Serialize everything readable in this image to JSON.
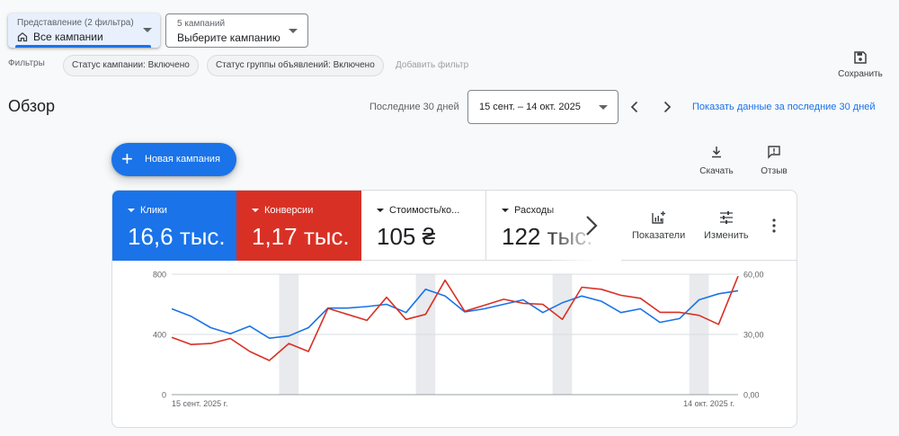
{
  "view_select": {
    "sub": "Представление (2 фильтра)",
    "value": "Все кампании"
  },
  "campaign_select": {
    "sub": "5 кампаний",
    "value": "Выберите кампанию"
  },
  "filters": {
    "label": "Фильтры",
    "chips": [
      "Статус кампании: Включено",
      "Статус группы объявлений: Включено"
    ],
    "add": "Добавить фильтр"
  },
  "save_label": "Сохранить",
  "title": "Обзор",
  "period_label": "Последние 30 дней",
  "date_range": "15 сент. – 14 окт. 2025",
  "show_link": "Показать данные за последние 30 дней",
  "new_campaign": "Новая кампания",
  "download_label": "Скачать",
  "feedback_label": "Отзыв",
  "metrics": [
    {
      "label": "Клики",
      "value": "16,6 тыс.",
      "color": "#1a73e8"
    },
    {
      "label": "Конверсии",
      "value": "1,17 тыс.",
      "color": "#d93025"
    },
    {
      "label": "Стоимость/ко...",
      "value": "105 ₴"
    },
    {
      "label": "Расходы",
      "value": "122 тыс. ₴"
    }
  ],
  "metrics_tools": {
    "indicators": "Показатели",
    "edit": "Изменить"
  },
  "chart_data": {
    "type": "line",
    "x_labels": [
      "15 сент. 2025 г.",
      "14 окт. 2025 г."
    ],
    "y_left": {
      "ticks": [
        "0",
        "400",
        "800"
      ],
      "max": 800
    },
    "y_right": {
      "ticks": [
        "0,00",
        "30,00",
        "60,00"
      ],
      "max": 60
    },
    "weekend_bands": [
      6,
      13,
      20,
      27
    ],
    "series": [
      {
        "name": "Клики",
        "color": "#1a73e8",
        "axis": "left",
        "values": [
          570,
          520,
          445,
          405,
          455,
          375,
          390,
          445,
          575,
          575,
          585,
          600,
          545,
          700,
          655,
          550,
          570,
          600,
          630,
          545,
          610,
          655,
          620,
          545,
          570,
          480,
          505,
          630,
          670,
          690
        ]
      },
      {
        "name": "Конверсии",
        "color": "#d93025",
        "axis": "right",
        "values": [
          28.5,
          25,
          25.5,
          28,
          21.5,
          17,
          25.5,
          21.5,
          43,
          40,
          37,
          48.5,
          37.5,
          40,
          57,
          41.5,
          44.5,
          47.5,
          45.5,
          45,
          37.5,
          53.5,
          52.5,
          49.5,
          48,
          41,
          41,
          39.5,
          35,
          59
        ]
      }
    ]
  }
}
